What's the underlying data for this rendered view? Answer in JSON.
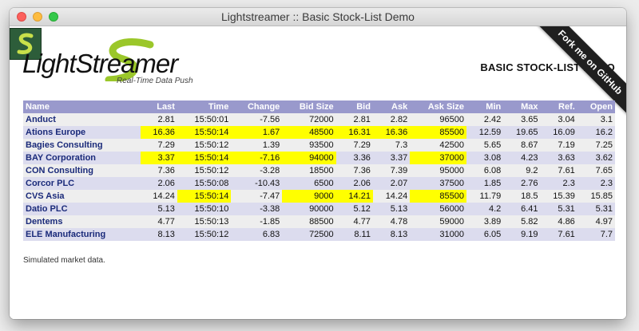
{
  "window": {
    "title": "Lightstreamer :: Basic Stock-List Demo"
  },
  "logo": {
    "brand": "LightStreamer",
    "tagline": "Real-Time Data Push"
  },
  "page": {
    "heading": "BASIC STOCK-LIST DEMO",
    "ribbon": "Fork me on GitHub",
    "footer_note": "Simulated market data."
  },
  "table": {
    "headers": [
      "Name",
      "Last",
      "Time",
      "Change",
      "Bid Size",
      "Bid",
      "Ask",
      "Ask Size",
      "Min",
      "Max",
      "Ref.",
      "Open"
    ],
    "rows": [
      {
        "cells": [
          "Anduct",
          "2.81",
          "15:50:01",
          "-7.56",
          "72000",
          "2.81",
          "2.82",
          "96500",
          "2.42",
          "3.65",
          "3.04",
          "3.1"
        ],
        "highlight": []
      },
      {
        "cells": [
          "Ations Europe",
          "16.36",
          "15:50:14",
          "1.67",
          "48500",
          "16.31",
          "16.36",
          "85500",
          "12.59",
          "19.65",
          "16.09",
          "16.2"
        ],
        "highlight": [
          1,
          2,
          3,
          4,
          5,
          6,
          7
        ]
      },
      {
        "cells": [
          "Bagies Consulting",
          "7.29",
          "15:50:12",
          "1.39",
          "93500",
          "7.29",
          "7.3",
          "42500",
          "5.65",
          "8.67",
          "7.19",
          "7.25"
        ],
        "highlight": []
      },
      {
        "cells": [
          "BAY Corporation",
          "3.37",
          "15:50:14",
          "-7.16",
          "94000",
          "3.36",
          "3.37",
          "37000",
          "3.08",
          "4.23",
          "3.63",
          "3.62"
        ],
        "highlight": [
          1,
          2,
          3,
          4,
          7
        ]
      },
      {
        "cells": [
          "CON Consulting",
          "7.36",
          "15:50:12",
          "-3.28",
          "18500",
          "7.36",
          "7.39",
          "95000",
          "6.08",
          "9.2",
          "7.61",
          "7.65"
        ],
        "highlight": []
      },
      {
        "cells": [
          "Corcor PLC",
          "2.06",
          "15:50:08",
          "-10.43",
          "6500",
          "2.06",
          "2.07",
          "37500",
          "1.85",
          "2.76",
          "2.3",
          "2.3"
        ],
        "highlight": []
      },
      {
        "cells": [
          "CVS Asia",
          "14.24",
          "15:50:14",
          "-7.47",
          "9000",
          "14.21",
          "14.24",
          "85500",
          "11.79",
          "18.5",
          "15.39",
          "15.85"
        ],
        "highlight": [
          2,
          4,
          5,
          7
        ]
      },
      {
        "cells": [
          "Datio PLC",
          "5.13",
          "15:50:10",
          "-3.38",
          "90000",
          "5.12",
          "5.13",
          "56000",
          "4.2",
          "6.41",
          "5.31",
          "5.31"
        ],
        "highlight": []
      },
      {
        "cells": [
          "Dentems",
          "4.77",
          "15:50:13",
          "-1.85",
          "88500",
          "4.77",
          "4.78",
          "59000",
          "3.89",
          "5.82",
          "4.86",
          "4.97"
        ],
        "highlight": []
      },
      {
        "cells": [
          "ELE Manufacturing",
          "8.13",
          "15:50:12",
          "6.83",
          "72500",
          "8.11",
          "8.13",
          "31000",
          "6.05",
          "9.19",
          "7.61",
          "7.7"
        ],
        "highlight": []
      }
    ]
  }
}
